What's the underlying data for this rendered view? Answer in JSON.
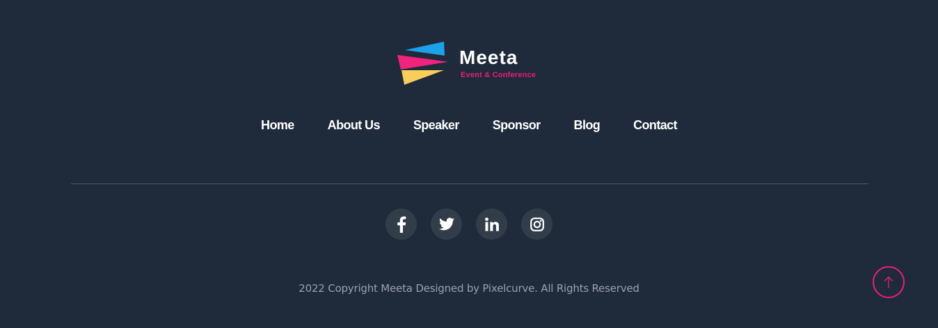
{
  "brand": {
    "name": "Meeta",
    "tagline": "Event & Conference",
    "colors": {
      "blue": "#1aa3e8",
      "pink": "#f0247c",
      "yellow": "#f6cf5a"
    }
  },
  "nav": {
    "items": [
      {
        "label": "Home"
      },
      {
        "label": "About Us"
      },
      {
        "label": "Speaker"
      },
      {
        "label": "Sponsor"
      },
      {
        "label": "Blog"
      },
      {
        "label": "Contact"
      }
    ]
  },
  "social": [
    {
      "icon": "facebook-icon"
    },
    {
      "icon": "twitter-icon"
    },
    {
      "icon": "linkedin-icon"
    },
    {
      "icon": "instagram-icon"
    }
  ],
  "copyright": "2022 Copyright Meeta Designed by Pixelcurve. All Rights Reserved",
  "scroll_top": {
    "icon": "arrow-up-icon"
  },
  "theme": {
    "background": "#1f2a3a",
    "accent": "#e91e78",
    "text": "#ffffff",
    "muted_text": "#9aa1ac",
    "social_bg": "#323d4a",
    "divider": "#4a5566"
  }
}
